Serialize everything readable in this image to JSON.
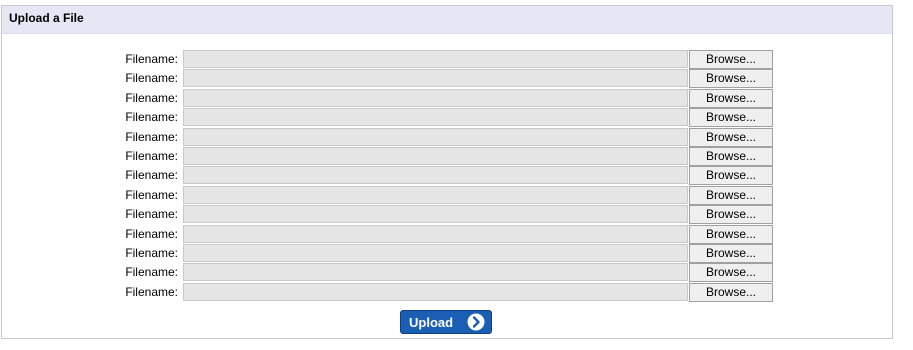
{
  "header": {
    "title": "Upload a File"
  },
  "file_rows": [
    {
      "label": "Filename:",
      "value": "",
      "browse_label": "Browse..."
    },
    {
      "label": "Filename:",
      "value": "",
      "browse_label": "Browse..."
    },
    {
      "label": "Filename:",
      "value": "",
      "browse_label": "Browse..."
    },
    {
      "label": "Filename:",
      "value": "",
      "browse_label": "Browse..."
    },
    {
      "label": "Filename:",
      "value": "",
      "browse_label": "Browse..."
    },
    {
      "label": "Filename:",
      "value": "",
      "browse_label": "Browse..."
    },
    {
      "label": "Filename:",
      "value": "",
      "browse_label": "Browse..."
    },
    {
      "label": "Filename:",
      "value": "",
      "browse_label": "Browse..."
    },
    {
      "label": "Filename:",
      "value": "",
      "browse_label": "Browse..."
    },
    {
      "label": "Filename:",
      "value": "",
      "browse_label": "Browse..."
    },
    {
      "label": "Filename:",
      "value": "",
      "browse_label": "Browse..."
    },
    {
      "label": "Filename:",
      "value": "",
      "browse_label": "Browse..."
    },
    {
      "label": "Filename:",
      "value": "",
      "browse_label": "Browse..."
    }
  ],
  "upload_button": {
    "label": "Upload",
    "icon": "chevron-right-circle-icon"
  },
  "colors": {
    "header_bg": "#e6e6f5",
    "input_bg": "#e5e5e5",
    "upload_button_bg": "#1a5fb4"
  }
}
